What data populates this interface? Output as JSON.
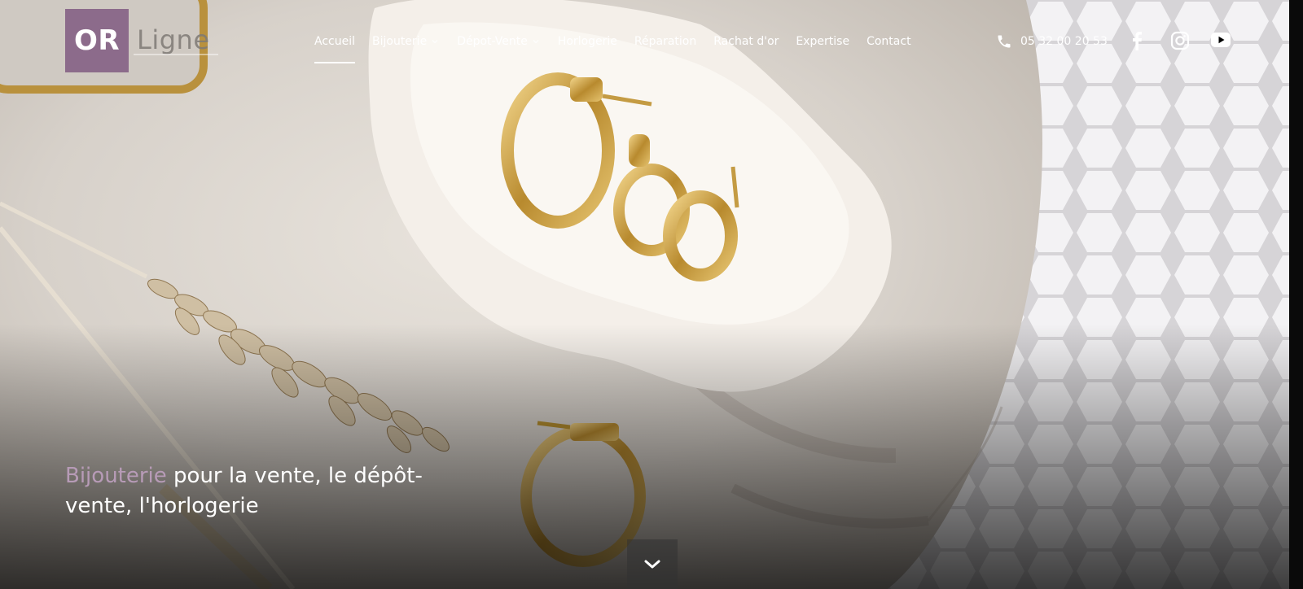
{
  "brand": {
    "logo_mark": "OR",
    "logo_word": "Ligne"
  },
  "nav": {
    "items": [
      {
        "label": "Accueil",
        "active": true,
        "has_dropdown": false
      },
      {
        "label": "Bijouterie",
        "active": false,
        "has_dropdown": true
      },
      {
        "label": "Dépot-Vente",
        "active": false,
        "has_dropdown": true
      },
      {
        "label": "Horlogerie",
        "active": false,
        "has_dropdown": false
      },
      {
        "label": "Réparation",
        "active": false,
        "has_dropdown": false
      },
      {
        "label": "Rachat d'or",
        "active": false,
        "has_dropdown": false
      },
      {
        "label": "Expertise",
        "active": false,
        "has_dropdown": false
      },
      {
        "label": "Contact",
        "active": false,
        "has_dropdown": false
      }
    ]
  },
  "contact": {
    "phone": "05 32 00 20 53",
    "phone_icon": "phone-icon"
  },
  "social": [
    {
      "icon": "facebook-icon"
    },
    {
      "icon": "instagram-icon"
    },
    {
      "icon": "youtube-icon"
    }
  ],
  "hero": {
    "headline_accent": "Bijouterie",
    "headline_rest": " pour la vente, le dépôt-vente, l'horlogerie",
    "scroll_icon": "chevron-down-icon"
  },
  "colors": {
    "accent": "#8c6b8b",
    "accent_text": "#b79bb7",
    "text": "#ffffff"
  }
}
